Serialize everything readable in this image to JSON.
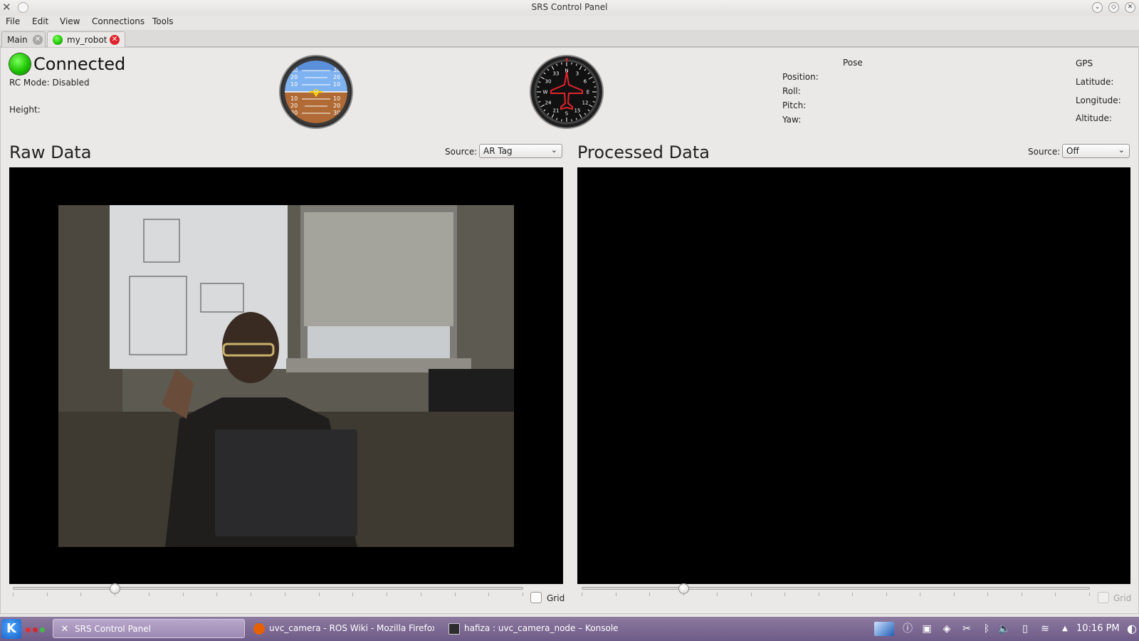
{
  "window": {
    "title": "SRS Control Panel"
  },
  "menu": [
    "File",
    "Edit",
    "View",
    "Connections",
    "Tools"
  ],
  "tabs": [
    {
      "label": "Main",
      "active": false
    },
    {
      "label": "my_robot",
      "active": true
    }
  ],
  "status": {
    "connection": "Connected",
    "rc_mode": "RC Mode: Disabled",
    "height_label": "Height:"
  },
  "attitude_indicator": {
    "pitch_marks_upper": [
      "30",
      "20",
      "10"
    ],
    "pitch_marks_lower": [
      "10",
      "20",
      "30"
    ]
  },
  "heading_indicator": {
    "marks": [
      "N",
      "3",
      "6",
      "E",
      "12",
      "15",
      "S",
      "21",
      "24",
      "W",
      "30",
      "33"
    ]
  },
  "pose": {
    "title": "Pose",
    "position_label": "Position:",
    "roll_label": "Roll:",
    "pitch_label": "Pitch:",
    "yaw_label": "Yaw:"
  },
  "gps": {
    "title": "GPS",
    "latitude_label": "Latitude:",
    "longitude_label": "Longitude:",
    "altitude_label": "Altitude:"
  },
  "raw_data": {
    "title": "Raw Data",
    "source_label": "Source:",
    "source_value": "AR Tag",
    "grid_label": "Grid",
    "grid_checked": false,
    "slider_value_fraction": 0.2
  },
  "processed_data": {
    "title": "Processed Data",
    "source_label": "Source:",
    "source_value": "Off",
    "grid_label": "Grid",
    "grid_checked": false,
    "grid_enabled": false,
    "slider_value_fraction": 0.2
  },
  "taskbar": {
    "tasks": [
      {
        "label": "SRS Control Panel",
        "icon": "srs-app-icon",
        "active": true
      },
      {
        "label": "uvc_camera - ROS Wiki - Mozilla Firefox",
        "icon": "firefox-icon",
        "active": false
      },
      {
        "label": "hafiza : uvc_camera_node – Konsole",
        "icon": "konsole-icon",
        "active": false
      }
    ],
    "clock": "10:16 PM"
  }
}
